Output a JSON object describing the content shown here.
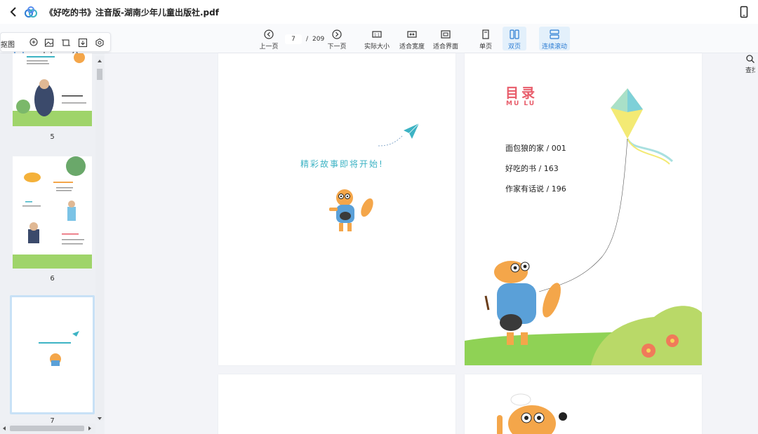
{
  "window": {
    "title": "《好吃的书》注音版-湖南少年儿童出版社.pdf"
  },
  "toolbar": {
    "prev_page": "上一页",
    "next_page": "下一页",
    "current_page": "7",
    "page_separator": "/",
    "total_pages": "209",
    "actual_size": "实际大小",
    "fit_width": "适合宽度",
    "fit_page": "适合界面",
    "single_page": "单页",
    "double_page": "双页",
    "continuous_scroll": "连续滚动",
    "search_partial": "查找"
  },
  "sidebar": {
    "popup_label": "抠图",
    "thumbnails": [
      {
        "page": "5"
      },
      {
        "page": "6"
      },
      {
        "page": "7"
      }
    ]
  },
  "pages": {
    "left_text": "精彩故事即将开始!",
    "toc_title": "目录",
    "toc_sub": "MU  LU",
    "toc_items": [
      "面包狼的家 / 001",
      "好吃的书 / 163",
      "作家有话说 / 196"
    ]
  },
  "colors": {
    "accent": "#2b7cd3",
    "toc_red": "#e85c6a",
    "teal": "#3db3c4"
  }
}
